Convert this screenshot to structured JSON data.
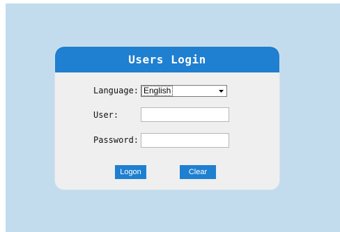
{
  "login": {
    "title": "Users Login",
    "language_label": "Language:",
    "language_selected": "English",
    "user_label": "User:",
    "user_value": "",
    "password_label": "Password:",
    "password_value": "",
    "logon_label": "Logon",
    "clear_label": "Clear"
  },
  "colors": {
    "page_background": "#c2dcee",
    "header": "#1f7fd0",
    "card": "#efefef",
    "button": "#1f7fd0"
  },
  "icons": {
    "select_arrow": "chevron-down-icon"
  }
}
